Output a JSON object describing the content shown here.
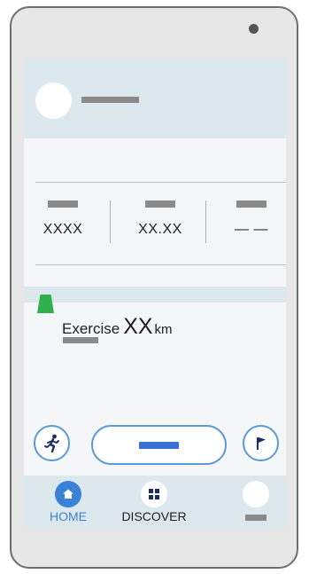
{
  "stats": [
    {
      "value": "XXXX"
    },
    {
      "value": "XX.XX"
    },
    {
      "value": "— —"
    }
  ],
  "exercise": {
    "label": "Exercise",
    "value": "XX",
    "unit": "km"
  },
  "tabs": [
    {
      "label": "HOME",
      "icon": "home-icon"
    },
    {
      "label": "DISCOVER",
      "icon": "grid-icon"
    },
    {
      "label": "",
      "icon": "blank-avatar-icon"
    }
  ],
  "colors": {
    "accent": "#3a82d6",
    "outline": "#5a9bd5",
    "flag": "#30b14c",
    "band": "#dde8ee"
  },
  "icons": {
    "run_button": "running-person-icon",
    "flag_button": "flag-icon"
  }
}
